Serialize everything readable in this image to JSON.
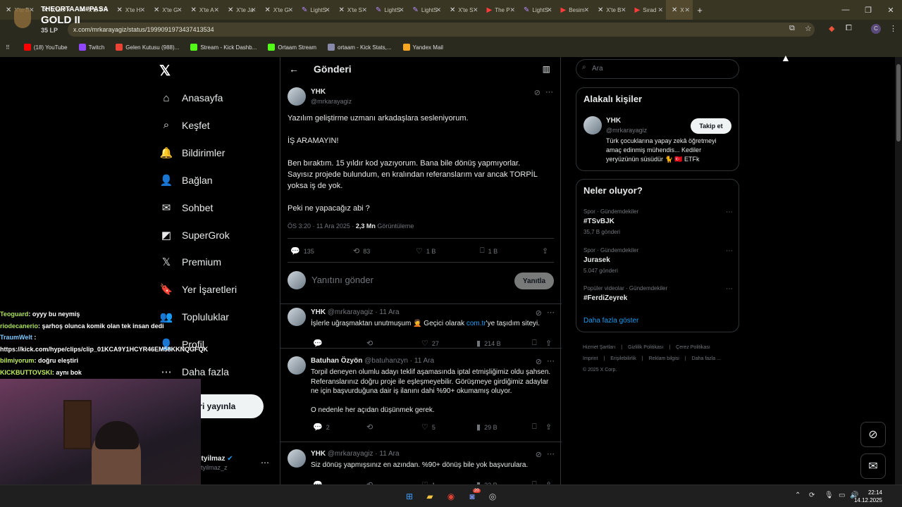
{
  "browser": {
    "tabs": [
      {
        "label": "X'te B",
        "fav": "x"
      },
      {
        "label": "X'te P",
        "fav": "x"
      },
      {
        "label": "X'te P",
        "fav": "x"
      },
      {
        "label": "X'te H",
        "fav": "x"
      },
      {
        "label": "X'te G",
        "fav": "x"
      },
      {
        "label": "X'te A",
        "fav": "x"
      },
      {
        "label": "X'te Ja",
        "fav": "x"
      },
      {
        "label": "X'te G",
        "fav": "x"
      },
      {
        "label": "LightS",
        "fav": "lightshot"
      },
      {
        "label": "X'te S",
        "fav": "x"
      },
      {
        "label": "LightS",
        "fav": "lightshot"
      },
      {
        "label": "LightS",
        "fav": "lightshot"
      },
      {
        "label": "X'te S",
        "fav": "x"
      },
      {
        "label": "The P",
        "fav": "youtube"
      },
      {
        "label": "LightS",
        "fav": "lightshot"
      },
      {
        "label": "Besim",
        "fav": "youtube"
      },
      {
        "label": "X'te B",
        "fav": "x"
      },
      {
        "label": "Sırad",
        "fav": "youtube"
      },
      {
        "label": "X",
        "fav": "x",
        "active": true
      }
    ],
    "new_tab": "+",
    "url": "x.com/mrkarayagiz/status/1999091973437413534",
    "bookmarks": [
      {
        "label": "(18) YouTube",
        "color": "#ff0000"
      },
      {
        "label": "Twitch",
        "color": "#9146ff"
      },
      {
        "label": "Gelen Kutusu (988)...",
        "color": "#ea4335"
      },
      {
        "label": "Stream - Kick Dashb...",
        "color": "#53fc18"
      },
      {
        "label": "Ortaam Stream",
        "color": "#53fc18"
      },
      {
        "label": "ortaam - Kick Stats,...",
        "color": "#8888aa"
      },
      {
        "label": "Yandex Mail",
        "color": "#f5a623"
      }
    ],
    "profile_initial": "C"
  },
  "stream_overlay": {
    "rank_team": "THEORTAAM#PASA",
    "rank_tier": "GOLD II",
    "rank_lp": "35 LP",
    "chat": [
      {
        "user": "Teoguard",
        "msg": ": oyyy bu neymiş",
        "color": "u1"
      },
      {
        "user": "riodecanerio",
        "msg": ": şarhoş olunca komik olan tek insan dedi",
        "color": "u1"
      },
      {
        "user": "TraumWelt",
        "msg": " :",
        "color": "u2"
      },
      {
        "user": "",
        "msg": "https://kick.com/hype/clips/clip_01KCA9Y1HCYR46EM58KKNQGFQK",
        "color": "u1"
      },
      {
        "user": "bilmiyorum",
        "msg": ": doğru eleştiri",
        "color": "u3"
      },
      {
        "user": "KICKBUTTOVSKI",
        "msg": ": aynı bok",
        "color": "u3"
      }
    ]
  },
  "nav": {
    "items": [
      {
        "label": "Anasayfa",
        "icon": "home-icon",
        "glyph": "⌂"
      },
      {
        "label": "Keşfet",
        "icon": "search-icon",
        "glyph": "⌕"
      },
      {
        "label": "Bildirimler",
        "icon": "bell-icon",
        "glyph": "🔔"
      },
      {
        "label": "Bağlan",
        "icon": "add-person-icon",
        "glyph": "👤"
      },
      {
        "label": "Sohbet",
        "icon": "mail-icon",
        "glyph": "✉"
      },
      {
        "label": "SuperGrok",
        "icon": "grok-icon",
        "glyph": "◩"
      },
      {
        "label": "Premium",
        "icon": "x-icon",
        "glyph": "𝕏"
      },
      {
        "label": "Yer İşaretleri",
        "icon": "bookmark-icon",
        "glyph": "🔖"
      },
      {
        "label": "Topluluklar",
        "icon": "people-icon",
        "glyph": "👥"
      },
      {
        "label": "Profil",
        "icon": "profile-icon",
        "glyph": "👤"
      },
      {
        "label": "Daha fazla",
        "icon": "more-icon",
        "glyph": "⋯"
      }
    ],
    "post_button": "eri yayınla",
    "profile_name": "etyilmaz",
    "profile_handle": "etyilmaz_z"
  },
  "main": {
    "title": "Gönderi",
    "tweet": {
      "name": "YHK",
      "handle": "@mrkarayagiz",
      "lines": [
        "Yazılım geliştirme uzmanı arkadaşlara sesleniyorum.",
        "",
        "İŞ ARAMAYIN!",
        "",
        "Ben bıraktım. 15 yıldır kod yazıyorum. Bana bile dönüş yapmıyorlar.",
        "Sayısız projede bulundum, en kralından referanslarım var ancak TORPİL",
        "yoksa iş de yok.",
        "",
        "Peki ne yapacağız abi ?"
      ],
      "time": "ÖS 3:20 · 11 Ara 2025 · ",
      "views": "2,3 Mn",
      "views_label": " Görüntüleme",
      "replies": "135",
      "retweets": "83",
      "likes": "1 B",
      "bookmarks": "1 B"
    },
    "reply_placeholder": "Yanıtını gönder",
    "reply_button": "Yanıtla",
    "replies": [
      {
        "name": "YHK",
        "meta": " @mrkarayagiz · 11 Ara",
        "text": "İşlerle uğraşmaktan unutmuşum 🤦 Geçici olarak ",
        "link": "com.tr",
        "text2": "'ye taşıdım siteyi.",
        "replies": "",
        "retweets": "",
        "likes": "27",
        "views": "214 B"
      },
      {
        "name": "Batuhan Özyön",
        "meta": " @batuhanzyn · 11 Ara",
        "text": "Torpil deneyen olumlu adayı teklif aşamasında iptal etmişliğimiz oldu şahsen. Referanslarınız doğru proje ile eşleşmeyebilir. Görüşmeye girdiğimiz adaylar ne için başvurduğuna dair iş ilanını dahi %90+ okumamış oluyor.",
        "text_b": "O nedenle her açıdan düşünmek gerek.",
        "replies": "2",
        "retweets": "",
        "likes": "5",
        "views": "29 B"
      },
      {
        "name": "YHK",
        "meta": " @mrkarayagiz · 11 Ara",
        "text": "Siz dönüş yapmışsınız en azından. %90+ dönüş bile yok başvurulara.",
        "replies": "",
        "retweets": "",
        "likes": "1",
        "views": "22 B"
      }
    ]
  },
  "sidebar": {
    "search_placeholder": "Ara",
    "relevant_title": "Alakalı kişiler",
    "person": {
      "name": "YHK",
      "handle": "@mrkarayagiz",
      "follow": "Takip et",
      "bio": "Türk çocuklarına yapay zekâ öğretmeyi amaç edinmiş mühendis... Kediler yeryüzünün süsüdür 🐈 🇹🇷 ETFk"
    },
    "trends_title": "Neler oluyor?",
    "trends": [
      {
        "cat": "Spor · Gündemdekiler",
        "title": "#TSvBJK",
        "count": "35,7 B gönderi"
      },
      {
        "cat": "Spor · Gündemdekiler",
        "title": "Jurasek",
        "count": "5.047 gönderi"
      },
      {
        "cat": "Popüler videolar · Gündemdekiler",
        "title": "#FerdiZeyrek",
        "count": ""
      }
    ],
    "show_more": "Daha fazla göster",
    "footer": [
      "Hizmet Şartları",
      "Gizlilik Politikası",
      "Çerez Politikası",
      "Imprint",
      "Erişilebilirlik",
      "Reklam bilgisi",
      "Daha fazla ...",
      "© 2025 X Corp."
    ]
  },
  "taskbar": {
    "time": "22:14",
    "date": "14.12.2025",
    "discord_badge": "20"
  }
}
